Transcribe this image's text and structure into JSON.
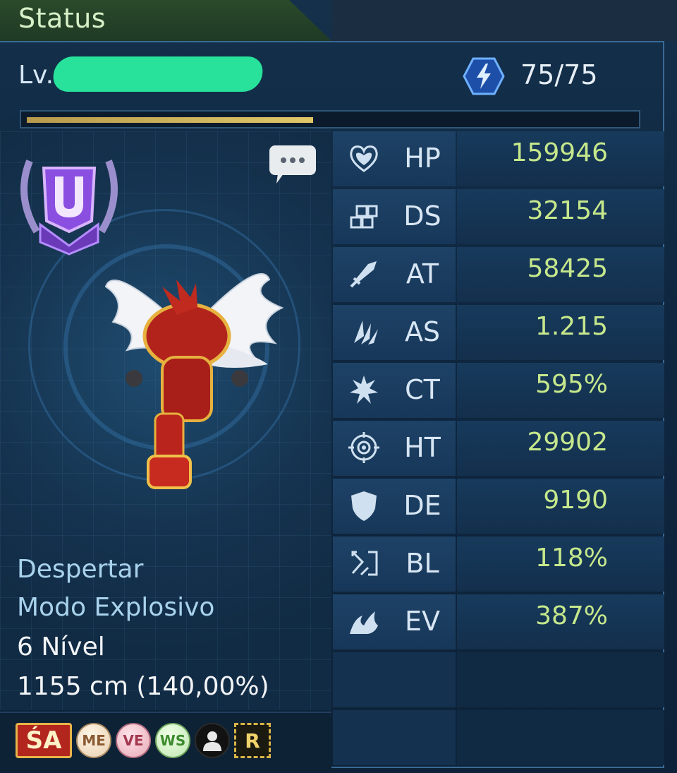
{
  "header": {
    "title": "Status"
  },
  "level": {
    "label": "Lv.",
    "energy": "75/75",
    "xp_fraction": 0.47
  },
  "character": {
    "lines": [
      "Despertar",
      "Modo Explosivo",
      "6 Nível",
      "1155 cm (140,00%)"
    ]
  },
  "badges": {
    "sa": "ŚA",
    "me": "ME",
    "ve": "VE",
    "ws": "WS",
    "r": "R"
  },
  "stats": [
    {
      "code": "HP",
      "value": "159946",
      "icon": "heart-icon"
    },
    {
      "code": "DS",
      "value": "32154",
      "icon": "cubes-icon"
    },
    {
      "code": "AT",
      "value": "58425",
      "icon": "sword-icon"
    },
    {
      "code": "AS",
      "value": "1.215",
      "icon": "claw-icon"
    },
    {
      "code": "CT",
      "value": "595%",
      "icon": "burst-icon"
    },
    {
      "code": "HT",
      "value": "29902",
      "icon": "crosshair-icon"
    },
    {
      "code": "DE",
      "value": "9190",
      "icon": "shield-icon"
    },
    {
      "code": "BL",
      "value": "118%",
      "icon": "block-arrow-icon"
    },
    {
      "code": "EV",
      "value": "387%",
      "icon": "wave-icon"
    }
  ],
  "colors": {
    "value_green": "#c6e88c",
    "tab_green": "#7ab650",
    "panel_blue": "#173759"
  }
}
